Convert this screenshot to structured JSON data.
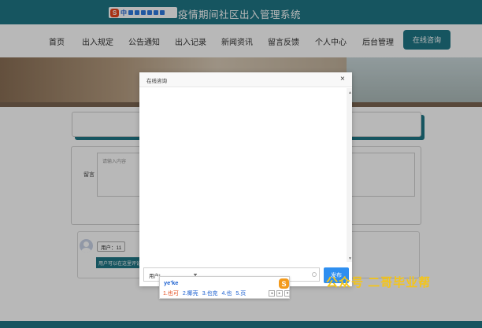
{
  "header": {
    "site_title": "疫情期间社区出入管理系统",
    "ime_mode": "中"
  },
  "nav": {
    "items": [
      "首页",
      "出入规定",
      "公告通知",
      "出入记录",
      "新闻资讯",
      "留言反馈",
      "个人中心",
      "后台管理"
    ],
    "consult_button": "在线咨询"
  },
  "message_form": {
    "label": "留言",
    "placeholder": "请输入内容"
  },
  "message_list": {
    "user_tag": "用户：11",
    "reply_text": "用户可以在这里评论"
  },
  "modal": {
    "title": "在线咨询",
    "close": "×",
    "input_value": "用户|",
    "send_button": "发布"
  },
  "ime": {
    "pinyin": "ye'ke",
    "candidates": [
      "1.也可",
      "2.椰壳",
      "3.也克",
      "4.也",
      "5.页"
    ]
  },
  "watermark": "公众号 二哥毕业帮",
  "colors": {
    "primary": "#1f7685",
    "send_button": "#2f8ff0",
    "watermark": "#f5c518"
  }
}
